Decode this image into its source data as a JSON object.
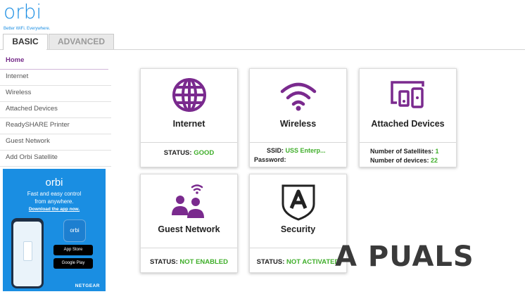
{
  "logo": {
    "word": "orbi",
    "tagline": "Better WiFi. Everywhere."
  },
  "tabs": [
    {
      "label": "BASIC"
    },
    {
      "label": "ADVANCED"
    }
  ],
  "sidebar": {
    "items": [
      {
        "label": "Home"
      },
      {
        "label": "Internet"
      },
      {
        "label": "Wireless"
      },
      {
        "label": "Attached Devices"
      },
      {
        "label": "ReadySHARE Printer"
      },
      {
        "label": "Guest Network"
      },
      {
        "label": "Add Orbi Satellite"
      }
    ]
  },
  "promo": {
    "logo": "orbi",
    "line1": "Fast and easy control",
    "line2": "from anywhere.",
    "link": "Download the app now.",
    "app_label": "orbi",
    "store1": "App Store",
    "store2": "Google Play",
    "brand": "NETGEAR"
  },
  "cards": {
    "internet": {
      "title": "Internet",
      "status_label": "STATUS:",
      "status_value": "GOOD"
    },
    "wireless": {
      "title": "Wireless",
      "ssid_label": "SSID:",
      "ssid_value": "USS Enterp...",
      "password_label": "Password:"
    },
    "devices": {
      "title": "Attached Devices",
      "satellites_label": "Number of Satellites:",
      "satellites_value": "1",
      "devices_label": "Number of devices:",
      "devices_value": "22"
    },
    "guest": {
      "title": "Guest Network",
      "status_label": "STATUS:",
      "status_value": "NOT ENABLED"
    },
    "security": {
      "title": "Security",
      "status_label": "STATUS:",
      "status_value": "NOT ACTIVATED"
    }
  },
  "watermark": {
    "text": "A PUALS"
  },
  "colors": {
    "accent": "#772d8a",
    "brand_blue": "#1d8fe3",
    "status_green": "#3fae2a",
    "icon_purple": "#7a2a8e"
  },
  "icons": [
    "globe-icon",
    "wifi-icon",
    "devices-icon",
    "guest-users-icon",
    "security-shield-icon"
  ]
}
